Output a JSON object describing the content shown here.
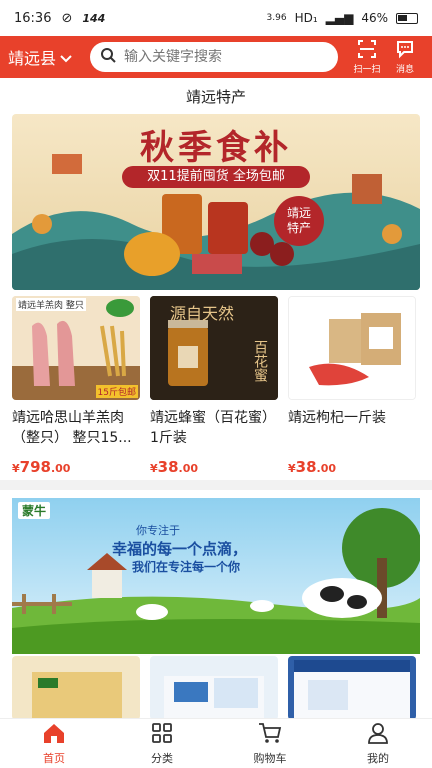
{
  "status_bar": {
    "time": "16:36",
    "net_speed": "144",
    "kbs": "3.96",
    "hd": "HD₁",
    "battery": "46%"
  },
  "header": {
    "city": "靖远县",
    "search_placeholder": "输入关键字搜索",
    "scan_label": "扫一扫",
    "msg_label": "消息"
  },
  "section_title": "靖远特产",
  "banner": {
    "headline": "秋季食补",
    "sub": "双11提前囤货 全场包邮",
    "badge_line1": "靖远",
    "badge_line2": "特产"
  },
  "products": [
    {
      "name": "靖远哈思山羊羔肉（整只） 整只15...",
      "price_main": "798",
      "price_dec": ".00",
      "img_tag": "靖远羊羔肉 整只",
      "img_note": "15斤包邮"
    },
    {
      "name": "靖远蜂蜜（百花蜜）1斤装",
      "price_main": "38",
      "price_dec": ".00",
      "img_tag": "源自天然",
      "img_note": "百花蜜"
    },
    {
      "name": "靖远枸杞一斤装",
      "price_main": "38",
      "price_dec": ".00",
      "img_tag": "",
      "img_note": ""
    }
  ],
  "banner2": {
    "brand": "蒙牛",
    "line1": "你专注于",
    "line2": "幸福的每一个点滴，",
    "line3": "我们在专注每一个你"
  },
  "tabs": [
    {
      "label": "首页",
      "icon": "home-icon"
    },
    {
      "label": "分类",
      "icon": "grid-icon"
    },
    {
      "label": "购物车",
      "icon": "cart-icon"
    },
    {
      "label": "我的",
      "icon": "user-icon"
    }
  ],
  "colors": {
    "accent": "#e8412b"
  }
}
